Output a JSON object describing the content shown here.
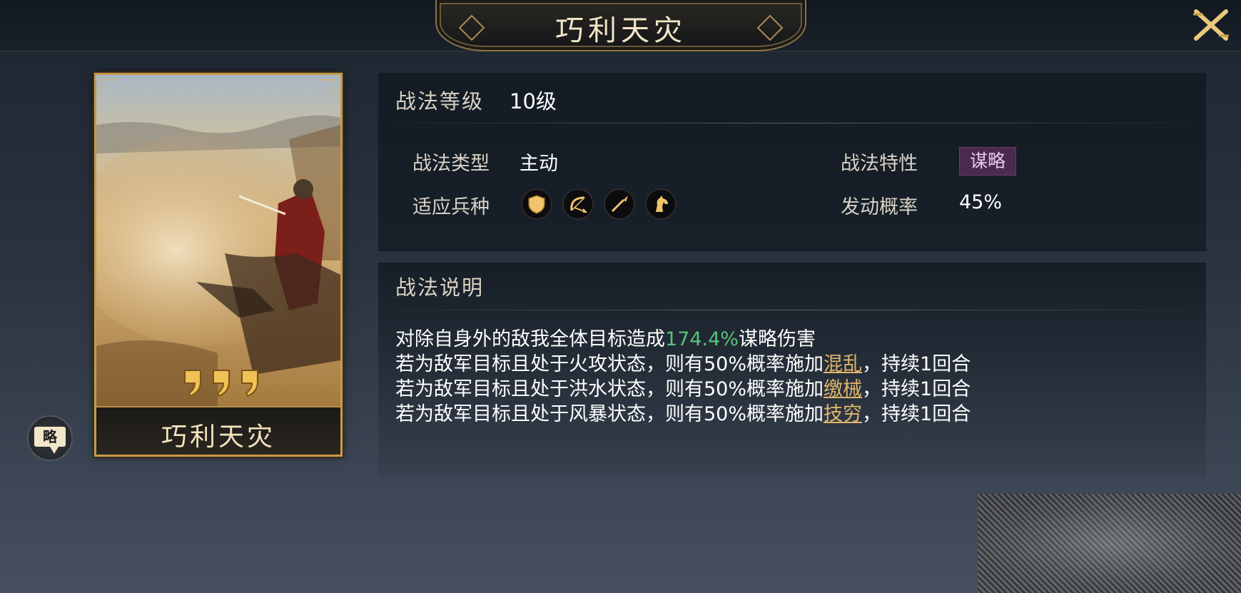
{
  "header": {
    "title": "巧利天灾",
    "close_icon": "close-icon"
  },
  "card": {
    "name": "巧利天灾",
    "grade_icons": [
      "grade-mark-icon",
      "grade-mark-icon",
      "grade-mark-icon"
    ]
  },
  "side_badge": {
    "label": "略"
  },
  "info": {
    "level_label": "战法等级",
    "level_value": "10级",
    "type_label": "战法类型",
    "type_value": "主动",
    "trait_label": "战法特性",
    "trait_value": "谋略",
    "troops_label": "适应兵种",
    "troops": [
      "shield-icon",
      "bow-icon",
      "spear-icon",
      "horse-icon"
    ],
    "rate_label": "发动概率",
    "rate_value": "45%"
  },
  "description": {
    "title": "战法说明",
    "line1_pre": "对除自身外的敌我全体目标造成",
    "line1_value": "174.4%",
    "line1_post": "谋略伤害",
    "line2_pre": "若为敌军目标且处于火攻状态，则有50%概率施加",
    "line2_link": "混乱",
    "line2_post": "，持续1回合",
    "line3_pre": "若为敌军目标且处于洪水状态，则有50%概率施加",
    "line3_link": "缴械",
    "line3_post": "，持续1回合",
    "line4_pre": "若为敌军目标且处于风暴状态，则有50%概率施加",
    "line4_link": "技穷",
    "line4_post": "，持续1回合"
  },
  "colors": {
    "accent_gold": "#c79b4a",
    "highlight_green": "#59c27a",
    "link_gold": "#e0b56c",
    "trait_purple": "#4a2a4e"
  }
}
